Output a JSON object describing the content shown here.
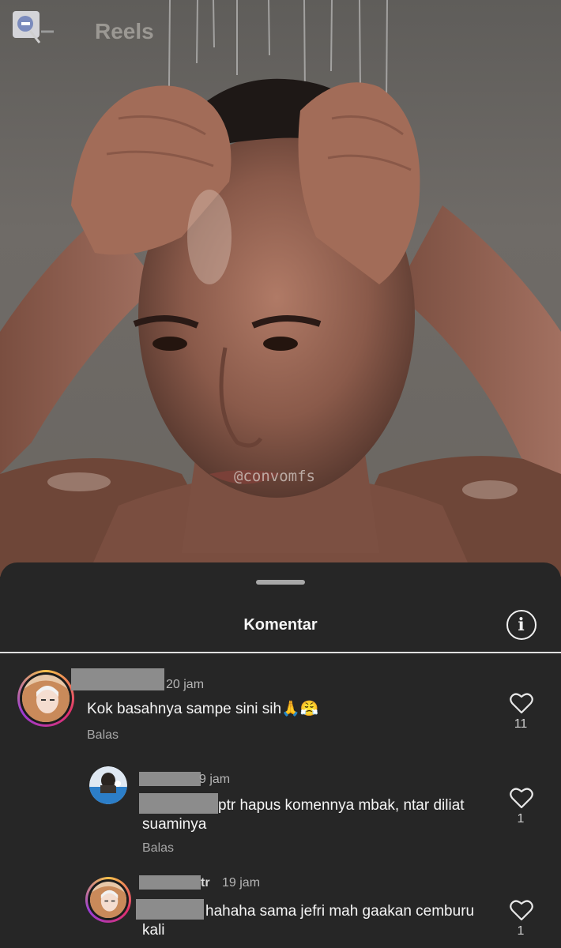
{
  "header": {
    "title": "Reels",
    "back_icon": "arrow-left-icon"
  },
  "video": {
    "watermark": "@convomfs"
  },
  "sheet": {
    "title": "Komentar",
    "info_icon": "info-icon",
    "info_glyph": "i"
  },
  "comments": [
    {
      "time": "20 jam",
      "text": "Kok basahnya sampe sini sih🙏😤",
      "reply": "Balas",
      "likes": "11"
    },
    {
      "time": "9 jam",
      "text_line1": "ptr hapus komennya mbak, ntar diliat",
      "text_line2": "suaminya",
      "reply": "Balas",
      "likes": "1"
    },
    {
      "user_suffix": "tr",
      "time": "19 jam",
      "text_line1": "hahaha sama jefri mah gaakan cemburu",
      "text_line2": "kali",
      "likes": "1"
    }
  ],
  "colors": {
    "sheet_bg": "#262626",
    "text": "#f5f5f5",
    "muted": "#a8a8a8",
    "redaction": "#8c8c8c"
  }
}
